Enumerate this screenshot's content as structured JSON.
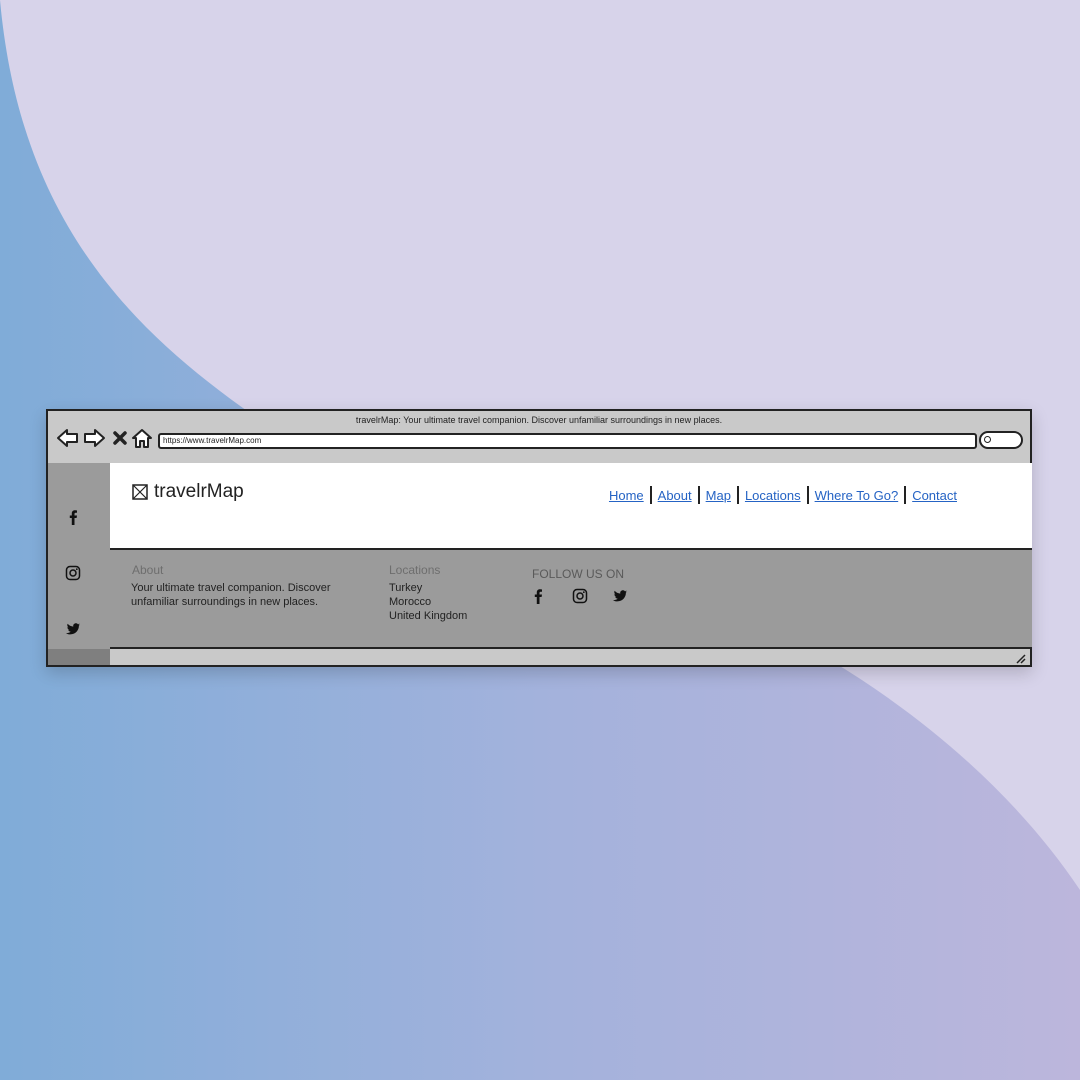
{
  "colors": {
    "background_blue": "#80acd8",
    "background_lavender": "#d7d3ea",
    "window_gray": "#c9c9c9",
    "footer_gray": "#9b9b9b",
    "link_blue": "#2563c4"
  },
  "browser": {
    "tagline": "travelrMap: Your ultimate travel companion. Discover unfamiliar surroundings in new places.",
    "url": "https://www.travelrMap.com",
    "buttons": [
      "back-arrow-icon",
      "forward-arrow-icon",
      "close-x-icon",
      "home-icon"
    ],
    "search_icon": "search-icon"
  },
  "sidebar": {
    "icons": [
      "facebook-icon",
      "instagram-icon",
      "twitter-icon"
    ]
  },
  "header": {
    "logo_text": "travelrMap",
    "logo_icon": "image-placeholder-icon",
    "nav": [
      "Home",
      "About",
      "Map",
      "Locations",
      "Where To Go?",
      "Contact"
    ]
  },
  "footer": {
    "about": {
      "title": "About",
      "text_line1": "Your ultimate travel companion. Discover",
      "text_line2": "unfamiliar surroundings in new places."
    },
    "locations": {
      "title": "Locations",
      "items": [
        "Turkey",
        "Morocco",
        "United Kingdom"
      ]
    },
    "follow": {
      "title": "FOLLOW US ON",
      "icons": [
        "facebook-icon",
        "instagram-icon",
        "twitter-icon"
      ]
    }
  }
}
